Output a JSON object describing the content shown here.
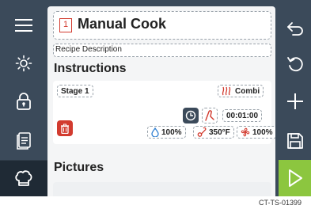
{
  "recipe": {
    "number": "1",
    "title": "Manual Cook",
    "description": "Recipe Description"
  },
  "sections": {
    "instructions": "Instructions",
    "pictures": "Pictures"
  },
  "stage": {
    "label": "Stage 1",
    "mode": "Combi",
    "duration": "00:01:00",
    "humidity": "100%",
    "temperature": "350°F",
    "fan": "100%"
  },
  "footer": {
    "code": "CT-TS-01399"
  },
  "colors": {
    "frame": "#3b4a5a",
    "active_nav": "#1f2a35",
    "accent_red": "#d23b2f",
    "start_green": "#8cc63f",
    "humidity_blue": "#2f7fd1"
  },
  "icons": {
    "left_nav": [
      "menu-icon",
      "brightness-icon",
      "lock-icon",
      "recipe-book-icon",
      "chef-hat-icon"
    ],
    "right_nav": [
      "back-icon",
      "undo-icon",
      "add-icon",
      "save-icon",
      "start-icon"
    ]
  }
}
